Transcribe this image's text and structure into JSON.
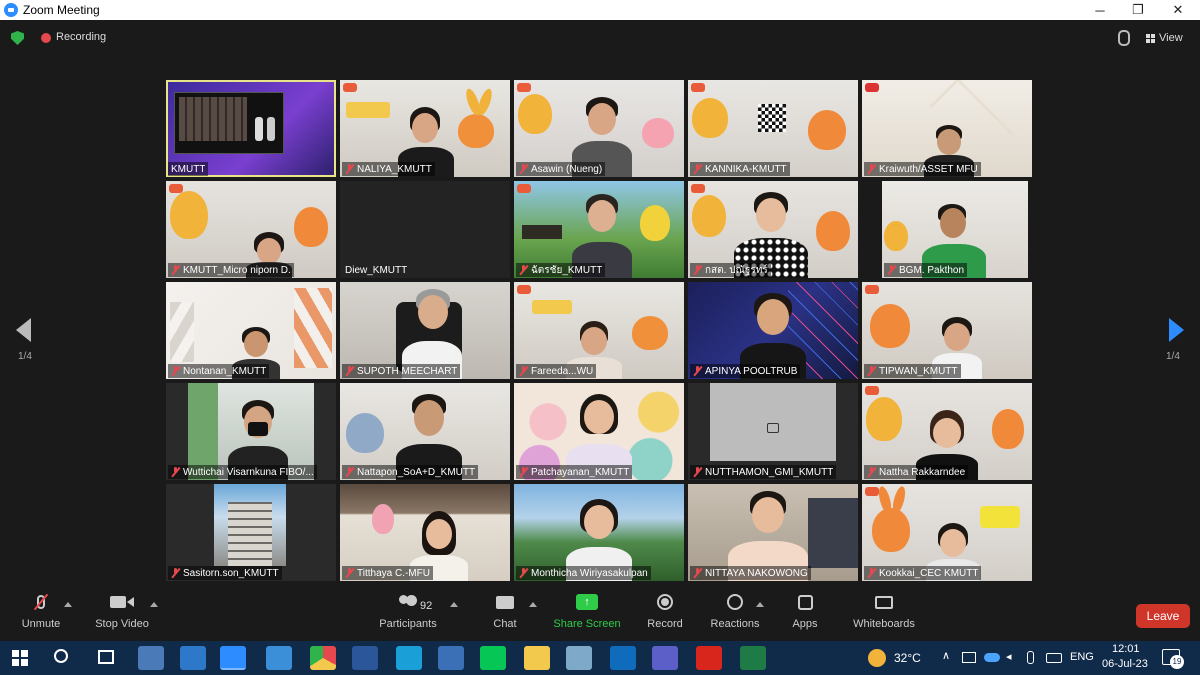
{
  "window": {
    "title": "Zoom Meeting",
    "minimize_icon": "minimize-icon",
    "restore_icon": "restore-icon",
    "close_icon": "close-icon"
  },
  "topbar": {
    "recording_label": "Recording",
    "view_label": "View"
  },
  "pager": {
    "left_label": "1/4",
    "right_label": "1/4"
  },
  "participants": [
    {
      "name": "KMUTT",
      "muted": false
    },
    {
      "name": "NALIYA_KMUTT",
      "muted": true
    },
    {
      "name": "Asawin (Nueng)",
      "muted": true
    },
    {
      "name": "KANNIKA-KMUTT",
      "muted": true
    },
    {
      "name": "Kraiwuth/ASSET MFU",
      "muted": true
    },
    {
      "name": "KMUTT_Micro niporn D.",
      "muted": true
    },
    {
      "name": "Diew_KMUTT",
      "muted": false
    },
    {
      "name": "ฉัตรชัย_KMUTT",
      "muted": true
    },
    {
      "name": "กสต. ปณัฐรทร์",
      "muted": true
    },
    {
      "name": "BGM. Pakthon",
      "muted": true
    },
    {
      "name": "Nontanan_KMUTT",
      "muted": true
    },
    {
      "name": "SUPOTH MEECHART",
      "muted": true
    },
    {
      "name": "Fareeda...WU",
      "muted": true
    },
    {
      "name": "APINYA POOLTRUB",
      "muted": true
    },
    {
      "name": "TIPWAN_KMUTT",
      "muted": true
    },
    {
      "name": "Wuttichai Visarnkuna FIBO/...",
      "muted": true
    },
    {
      "name": "Nattapon_SoA+D_KMUTT",
      "muted": true
    },
    {
      "name": "Patchayanan_KMUTT",
      "muted": true
    },
    {
      "name": "NUTTHAMON_GMI_KMUTT",
      "muted": true
    },
    {
      "name": "Nattha Rakkarndee",
      "muted": true
    },
    {
      "name": "Sasitorn.son_KMUTT",
      "muted": true
    },
    {
      "name": "Titthaya C.-MFU",
      "muted": true
    },
    {
      "name": "Monthicha Wiriyasakulpan",
      "muted": true
    },
    {
      "name": "NITTAYA NAKOWONG",
      "muted": true
    },
    {
      "name": "Kookkai_CEC KMUTT",
      "muted": true
    }
  ],
  "toolbar": {
    "unmute": "Unmute",
    "stop_video": "Stop Video",
    "participants": "Participants",
    "participants_count": "92",
    "chat": "Chat",
    "share_screen": "Share Screen",
    "record": "Record",
    "reactions": "Reactions",
    "apps": "Apps",
    "whiteboards": "Whiteboards",
    "leave": "Leave"
  },
  "taskbar": {
    "temperature": "32°C",
    "language": "ENG",
    "time": "12:01",
    "date": "06-Jul-23",
    "notifications": "19"
  },
  "colors": {
    "accent": "#2d8cff",
    "leave": "#d0352a",
    "share": "#2fcc4a",
    "muted": "#e5484d"
  }
}
